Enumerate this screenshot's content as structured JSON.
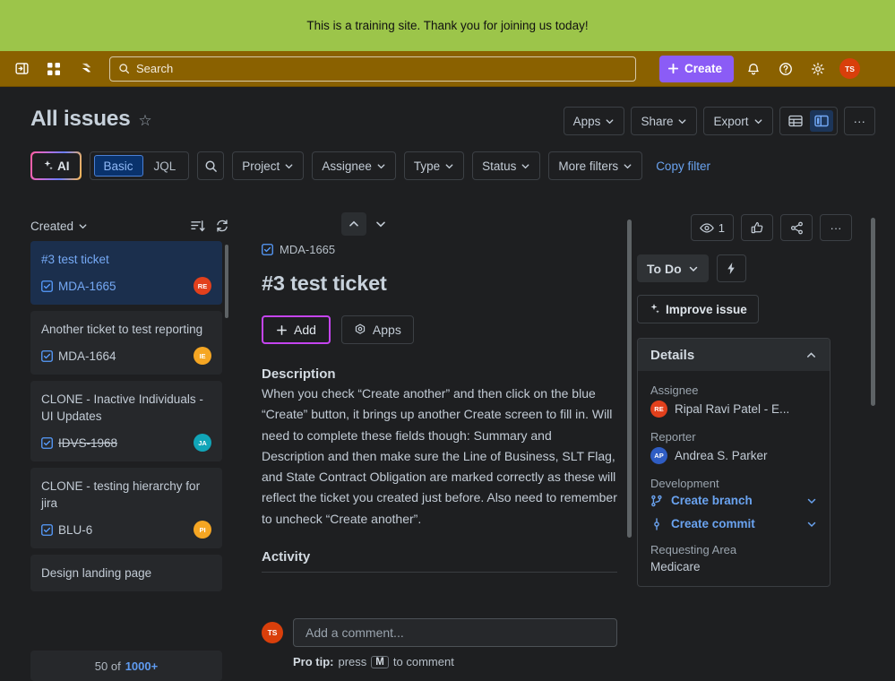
{
  "banner": {
    "text": "This is a training site. Thank you for joining us today!",
    "bg": "#9cc54a"
  },
  "topnav": {
    "bg": "#8a6100",
    "sidebar_toggle_label": "Expand sidebar",
    "app_switcher_label": "App switcher",
    "product_label": "Jira",
    "search_placeholder": "Search",
    "create_label": "Create",
    "notifications_label": "Notifications",
    "help_label": "Help",
    "settings_label": "Settings",
    "avatar_initials": "TS",
    "avatar_color": "#d93f0b"
  },
  "page": {
    "title": "All issues",
    "actions": [
      "Apps",
      "Share",
      "Export"
    ],
    "more_label": "···"
  },
  "filters": {
    "ai_label": "AI",
    "basic_label": "Basic",
    "jql_label": "JQL",
    "dropdowns": [
      "Project",
      "Assignee",
      "Type",
      "Status",
      "More filters"
    ],
    "copy_filter_label": "Copy filter"
  },
  "list": {
    "sort_label": "Created",
    "footer_count": "50 of",
    "footer_total": "1000+",
    "cards": [
      {
        "title": "#3 test ticket",
        "key": "MDA-1665",
        "avatar": "RE",
        "avatar_color": "#e2401c",
        "selected": true,
        "done": false
      },
      {
        "title": "Another ticket to test reporting",
        "key": "MDA-1664",
        "avatar": "IE",
        "avatar_color": "#f5a623",
        "selected": false,
        "done": false
      },
      {
        "title": "CLONE - Inactive Individuals - UI Updates",
        "key": "IDVS-1968",
        "avatar": "JA",
        "avatar_color": "#11a5b8",
        "selected": false,
        "done": true
      },
      {
        "title": "CLONE - testing hierarchy for jira",
        "key": "BLU-6",
        "avatar": "PI",
        "avatar_color": "#f5a623",
        "selected": false,
        "done": false
      },
      {
        "title": "Design landing page",
        "key": "",
        "avatar": "",
        "avatar_color": "#6b7178",
        "selected": false,
        "done": false
      }
    ]
  },
  "detail": {
    "issue_key": "MDA-1665",
    "title": "#3 test ticket",
    "add_label": "Add",
    "apps_label": "Apps",
    "description_heading": "Description",
    "description": "When you check “Create another” and then click on the blue “Create” button, it brings up another Create screen to fill in.  Will need to complete these fields though:  Summary and Description and then make sure the Line of Business, SLT Flag, and State Contract Obligation are marked correctly as these will reflect the ticket you created just before.  Also need to remember to uncheck “Create another”.",
    "activity_heading": "Activity",
    "comment_placeholder": "Add a comment...",
    "comment_avatar": "TS",
    "protip_bold": "Pro tip:",
    "protip_text_1": "press",
    "protip_key": "M",
    "protip_text_2": "to comment"
  },
  "sidebar": {
    "watch_count": "1",
    "watch_label": "Watchers",
    "like_label": "Like",
    "share_label": "Share",
    "more_label": "···",
    "status": "To Do",
    "actions_label": "Actions",
    "improve_label": "Improve issue",
    "details_heading": "Details",
    "fields": [
      {
        "label": "Assignee",
        "value": "Ripal Ravi Patel - E...",
        "avatar": "RE",
        "avatar_color": "#e2401c"
      },
      {
        "label": "Reporter",
        "value": "Andrea S. Parker",
        "avatar": "AP",
        "avatar_color": "#2f5dc4"
      }
    ],
    "development_label": "Development",
    "dev_links": [
      "Create branch",
      "Create commit"
    ],
    "requesting_area_label": "Requesting Area",
    "requesting_area_value": "Medicare"
  }
}
